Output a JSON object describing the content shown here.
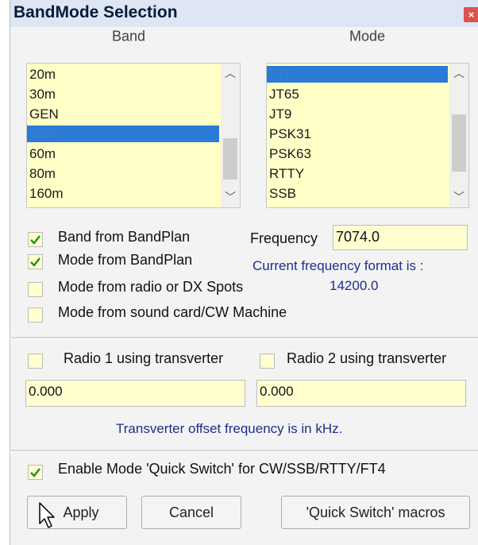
{
  "dialog": {
    "title": "BandMode Selection",
    "close": "×"
  },
  "band": {
    "header": "Band",
    "items": [
      "20m",
      "30m",
      "GEN",
      "40m",
      "60m",
      "80m",
      "160m"
    ],
    "selected": "40m"
  },
  "mode": {
    "header": "Mode",
    "items": [
      "FT8",
      "JT65",
      "JT9",
      "PSK31",
      "PSK63",
      "RTTY",
      "SSB"
    ],
    "selected": "FT8"
  },
  "options": {
    "band_from_bandplan": {
      "label": "Band from BandPlan",
      "checked": true
    },
    "mode_from_bandplan": {
      "label": "Mode from BandPlan",
      "checked": true
    },
    "mode_from_radio": {
      "label": "Mode from radio or DX Spots",
      "checked": false
    },
    "mode_from_sound": {
      "label": "Mode from sound card/CW Machine",
      "checked": false
    }
  },
  "frequency": {
    "label": "Frequency",
    "value": "7074.0",
    "format_note": "Current frequency format is :",
    "format_example": "14200.0"
  },
  "transverter": {
    "radio1": {
      "label": "Radio 1 using transverter",
      "checked": false,
      "value": "0.000"
    },
    "radio2": {
      "label": "Radio 2 using transverter",
      "checked": false,
      "value": "0.000"
    },
    "note": "Transverter offset frequency is in kHz."
  },
  "quick_switch": {
    "label": "Enable Mode 'Quick Switch' for CW/SSB/RTTY/FT4",
    "checked": true
  },
  "buttons": {
    "apply": "Apply",
    "cancel": "Cancel",
    "macros": "'Quick Switch' macros"
  },
  "colors": {
    "list_bg": "#ffffc8",
    "selection": "#2a7ad6",
    "check_green": "#1f8f1f",
    "note_blue": "#1e2e8a"
  }
}
